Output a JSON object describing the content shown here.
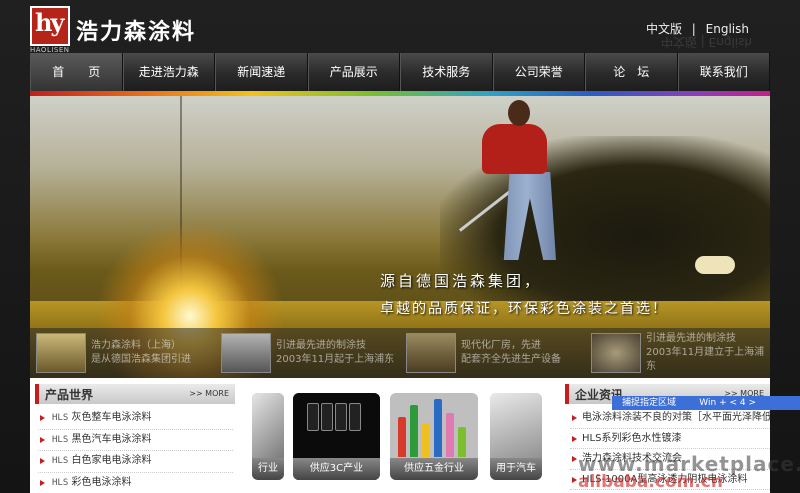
{
  "header": {
    "logo_mark": "hy",
    "logo_sub": "HAOLISEN",
    "brand_name": "浩力森涂料",
    "lang_cn": "中文版",
    "lang_sep": "|",
    "lang_en": "English"
  },
  "nav": {
    "items": [
      "首　　页",
      "走进浩力森",
      "新闻速递",
      "产品展示",
      "技术服务",
      "公司荣誉",
      "论　坛",
      "联系我们"
    ]
  },
  "banner": {
    "slogan_1": "源自德国浩森集团，",
    "slogan_2": "卓越的品质保证，环保彩色涂装之首选！",
    "thumbs": [
      {
        "line1": "浩力森涂料（上海）",
        "line2": "是从德国浩森集团引进"
      },
      {
        "line1": "引进最先进的制涂技",
        "line2": "2003年11月起于上海浦东"
      },
      {
        "line1": "现代化厂房，先进",
        "line2": "配套齐全先进生产设备"
      },
      {
        "line1": "引进最先进的制涂技",
        "line2": "2003年11月建立于上海浦东"
      }
    ]
  },
  "products": {
    "title": "产品世界",
    "more": ">> MORE",
    "items": [
      {
        "prefix": "HLS",
        "name": "灰色整车电泳涂料"
      },
      {
        "prefix": "HLS",
        "name": "黑色汽车电泳涂料"
      },
      {
        "prefix": "HLS",
        "name": "白色家电电泳涂料"
      },
      {
        "prefix": "HLS",
        "name": "彩色电泳涂料"
      }
    ]
  },
  "cards": [
    {
      "caption": "行业"
    },
    {
      "caption": "供应3C产业"
    },
    {
      "caption": "供应五金行业"
    },
    {
      "caption": "用于汽车"
    }
  ],
  "news": {
    "title": "企业资讯",
    "more": ">> MORE",
    "items": [
      "电泳涂料涂装不良的对策［水平面光泽降低］",
      "HLS系列彩色水性镀漆",
      "浩力森涂料技术交流会",
      "HLS-1000A型高泳透力阴极电泳涂料"
    ]
  },
  "overlay": {
    "capture_text": "捕捉指定区域",
    "capture_shortcut": "Win + < 4 >",
    "watermark": "www.marketplace.com",
    "watermark2": "alibaba.com.cn"
  },
  "colors": {
    "brand_red": "#b52418",
    "nav_bg": "#2a2a2a"
  }
}
